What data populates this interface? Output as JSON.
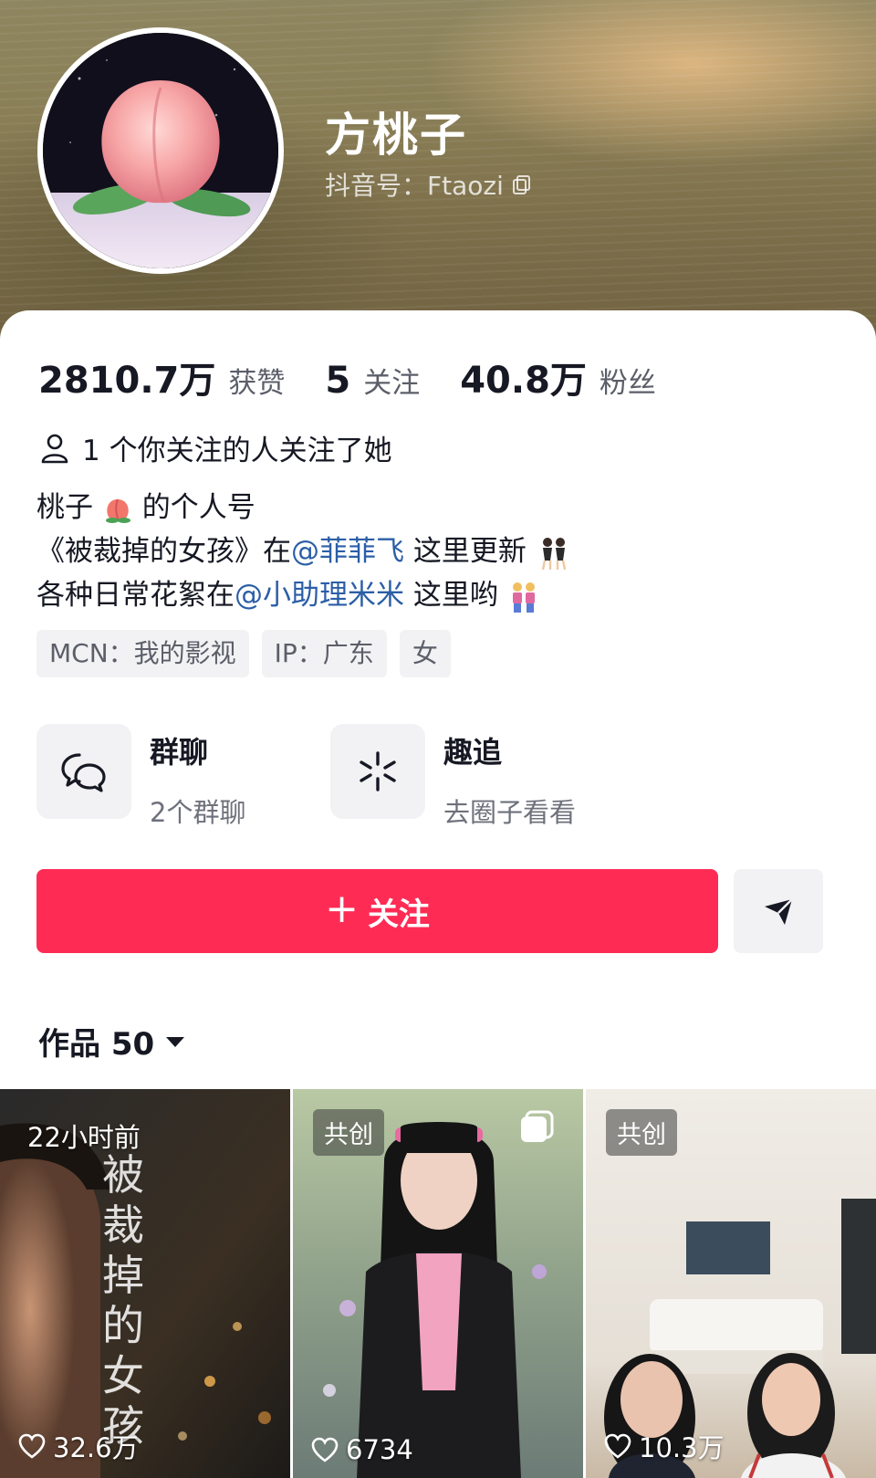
{
  "profile": {
    "name": "方桃子",
    "douyin_id": "抖音号：Ftaozi"
  },
  "stats": [
    {
      "value": "2810.7万",
      "label": "获赞"
    },
    {
      "value": "5",
      "label": "关注"
    },
    {
      "value": "40.8万",
      "label": "粉丝"
    }
  ],
  "mutual": "1 个你关注的人关注了她",
  "bio": {
    "line1_prefix": "桃子",
    "line1_suffix": " 的个人号",
    "line2_prefix": "《被裁掉的女孩》在",
    "line2_mention": "@菲菲飞",
    "line2_suffix": " 这里更新",
    "line3_prefix": "各种日常花絮在",
    "line3_mention": "@小助理米米",
    "line3_suffix": " 这里哟"
  },
  "tags": [
    "MCN：我的影视",
    "IP：广东",
    "女"
  ],
  "entries": [
    {
      "title": "群聊",
      "subtitle": "2个群聊",
      "icon": "chat-bubbles-icon"
    },
    {
      "title": "趣追",
      "subtitle": "去圈子看看",
      "icon": "sparkle-icon"
    }
  ],
  "actions": {
    "follow_label": "关注",
    "share_icon": "send-icon"
  },
  "works": {
    "label": "作品 50"
  },
  "videos": [
    {
      "badge": "",
      "time": "22小时前",
      "likes": "32.6万"
    },
    {
      "badge": "共创",
      "time": "",
      "likes": "6734"
    },
    {
      "badge": "共创",
      "time": "",
      "likes": "10.3万"
    }
  ],
  "colors": {
    "accent": "#fe2c55",
    "mention": "#2b5ea6"
  }
}
